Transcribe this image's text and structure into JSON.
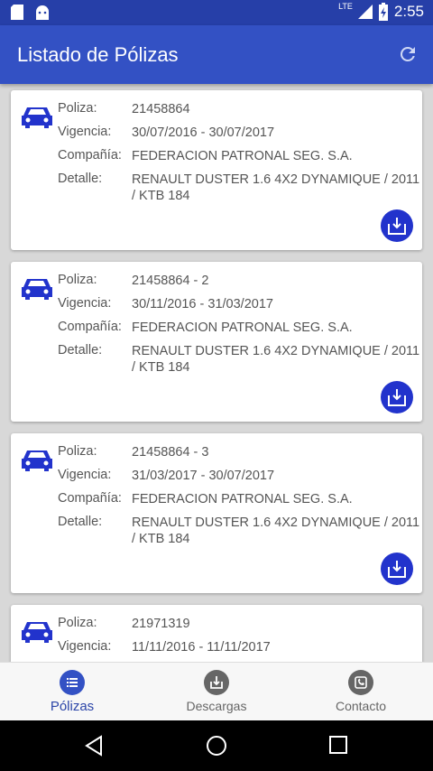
{
  "status_bar": {
    "time": "2:55",
    "network": "LTE"
  },
  "app_bar": {
    "title": "Listado de Pólizas"
  },
  "policies": [
    {
      "poliza_label": "Poliza:",
      "poliza": "21458864",
      "vigencia_label": "Vigencia:",
      "vigencia": "30/07/2016 - 30/07/2017",
      "compania_label": "Compañía:",
      "compania": "FEDERACION PATRONAL SEG. S.A.",
      "detalle_label": "Detalle:",
      "detalle": "RENAULT DUSTER 1.6 4X2 DYNAMIQUE / 2011 / KTB 184"
    },
    {
      "poliza_label": "Poliza:",
      "poliza": "21458864 - 2",
      "vigencia_label": "Vigencia:",
      "vigencia": "30/11/2016 - 31/03/2017",
      "compania_label": "Compañía:",
      "compania": "FEDERACION PATRONAL SEG. S.A.",
      "detalle_label": "Detalle:",
      "detalle": "RENAULT DUSTER 1.6 4X2 DYNAMIQUE / 2011 / KTB 184"
    },
    {
      "poliza_label": "Poliza:",
      "poliza": "21458864 - 3",
      "vigencia_label": "Vigencia:",
      "vigencia": "31/03/2017 - 30/07/2017",
      "compania_label": "Compañía:",
      "compania": "FEDERACION PATRONAL SEG. S.A.",
      "detalle_label": "Detalle:",
      "detalle": "RENAULT DUSTER 1.6 4X2 DYNAMIQUE / 2011 / KTB 184"
    },
    {
      "poliza_label": "Poliza:",
      "poliza": "21971319",
      "vigencia_label": "Vigencia:",
      "vigencia": "11/11/2016 - 11/11/2017"
    }
  ],
  "bottom_nav": {
    "items": [
      {
        "label": "Pólizas",
        "icon": "list-icon",
        "active": true
      },
      {
        "label": "Descargas",
        "icon": "download-icon",
        "active": false
      },
      {
        "label": "Contacto",
        "icon": "phone-icon",
        "active": false
      }
    ]
  },
  "colors": {
    "primary": "#3351c4",
    "status": "#263fa8",
    "accent": "#2233cc",
    "active_nav": "#2c45a8"
  }
}
